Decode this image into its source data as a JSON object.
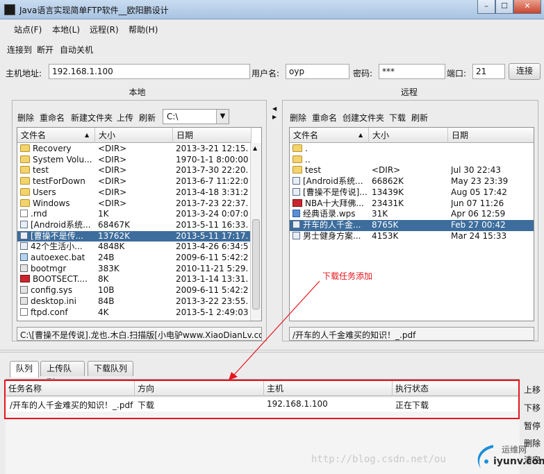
{
  "window": {
    "title": "Java语言实现简单FTP软件__欧阳鹏设计",
    "min_label": "–",
    "max_label": "☐",
    "close_label": "✕"
  },
  "menu": [
    "站点(F)",
    "本地(L)",
    "远程(R)",
    "帮助(H)"
  ],
  "toolbar": [
    "连接到",
    "断开",
    "自动关机"
  ],
  "connection": {
    "host_label": "主机地址:",
    "host_value": "192.168.1.100",
    "user_label": "用户名:",
    "user_value": "oyp",
    "password_label": "密码:",
    "password_value": "***",
    "port_label": "端口:",
    "port_value": "21",
    "connect_button": "连接"
  },
  "local": {
    "header": "本地",
    "tools": [
      "删除",
      "重命名",
      "新建文件夹",
      "上传",
      "刷新"
    ],
    "drive": "C:\\",
    "columns": [
      "文件名",
      "大小",
      "日期"
    ],
    "rows": [
      {
        "icon": "folder",
        "name": "Recovery",
        "size": "<DIR>",
        "date": "2013-3-21 12:15..."
      },
      {
        "icon": "folder",
        "name": "System Volu...",
        "size": "<DIR>",
        "date": "1970-1-1 8:00:00"
      },
      {
        "icon": "folder",
        "name": "test",
        "size": "<DIR>",
        "date": "2013-7-30 22:20..."
      },
      {
        "icon": "folder",
        "name": "testForDown",
        "size": "<DIR>",
        "date": "2013-6-7 11:22:06"
      },
      {
        "icon": "folder",
        "name": "Users",
        "size": "<DIR>",
        "date": "2013-4-18 3:31:24"
      },
      {
        "icon": "folder",
        "name": "Windows",
        "size": "<DIR>",
        "date": "2013-7-23 22:37..."
      },
      {
        "icon": "file",
        "name": ".rnd",
        "size": "1K",
        "date": "2013-3-24 0:07:06"
      },
      {
        "icon": "doc",
        "name": "[Android系统...",
        "size": "68467K",
        "date": "2013-5-11 16:33..."
      },
      {
        "icon": "doc",
        "name": "[曹操不是传...",
        "size": "13762K",
        "date": "2013-5-11 17:17...",
        "selected": true
      },
      {
        "icon": "doc",
        "name": "42个生活小...",
        "size": "4848K",
        "date": "2013-4-26 6:34:58"
      },
      {
        "icon": "exe",
        "name": "autoexec.bat",
        "size": "24B",
        "date": "2009-6-11 5:42:20"
      },
      {
        "icon": "sys",
        "name": "bootmgr",
        "size": "383K",
        "date": "2010-11-21 5:29..."
      },
      {
        "icon": "pdf",
        "name": "BOOTSECT....",
        "size": "8K",
        "date": "2013-1-14 13:31..."
      },
      {
        "icon": "sys",
        "name": "config.sys",
        "size": "10B",
        "date": "2009-6-11 5:42:20"
      },
      {
        "icon": "sys",
        "name": "desktop.ini",
        "size": "84B",
        "date": "2013-3-22 23:55..."
      },
      {
        "icon": "file",
        "name": "ftpd.conf",
        "size": "4K",
        "date": "2013-5-1 2:49:03"
      }
    ],
    "path": "C:\\[曹操不是传说].龙也.木白.扫描版[小电驴www.XiaoDianLv.com..."
  },
  "remote": {
    "header": "远程",
    "tools": [
      "删除",
      "重命名",
      "创建文件夹",
      "下载",
      "刷新"
    ],
    "columns": [
      "文件名",
      "大小",
      "日期"
    ],
    "rows": [
      {
        "icon": "folder",
        "name": ".",
        "size": "",
        "date": ""
      },
      {
        "icon": "folder",
        "name": "..",
        "size": "",
        "date": ""
      },
      {
        "icon": "folder",
        "name": "test",
        "size": "<DIR>",
        "date": "Jul 30 22:43"
      },
      {
        "icon": "doc",
        "name": "[Android系统...",
        "size": "66862K",
        "date": "May 23 23:39"
      },
      {
        "icon": "doc",
        "name": "[曹操不是传说]...",
        "size": "13439K",
        "date": "Aug 05 17:42"
      },
      {
        "icon": "pdf",
        "name": "NBA十大拜佛...",
        "size": "23431K",
        "date": "Jun 07 11:26"
      },
      {
        "icon": "wps",
        "name": "经典语录.wps",
        "size": "31K",
        "date": "Apr 06 12:59"
      },
      {
        "icon": "doc",
        "name": "开车的人千金...",
        "size": "8765K",
        "date": "Feb 27 00:42",
        "selected": true
      },
      {
        "icon": "doc",
        "name": "男士健身方案...",
        "size": "4153K",
        "date": "Mar 24 15:33"
      }
    ],
    "path": "/开车的人千金难买的知识！_.pdf"
  },
  "queue": {
    "tabs": [
      "队列",
      "上传队列",
      "下载队列"
    ],
    "columns": [
      "任务名称",
      "方向",
      "主机",
      "执行状态"
    ],
    "rows": [
      {
        "name": "/开车的人千金难买的知识！_.pdf",
        "direction": "下载",
        "host": "192.168.1.100",
        "status": "正在下载"
      }
    ],
    "side_buttons": [
      "上移",
      "下移",
      "暂停",
      "删除",
      "清空"
    ]
  },
  "annotation": "下载任务添加",
  "watermark": {
    "url": "http://blog.csdn.net/ou",
    "logo_top": "运维网",
    "logo_bottom": "iyunv.com"
  },
  "colors": {
    "selection": "#3d6d9c",
    "annotation_red": "#e8141b",
    "titlebar": "#b8cfe9"
  }
}
